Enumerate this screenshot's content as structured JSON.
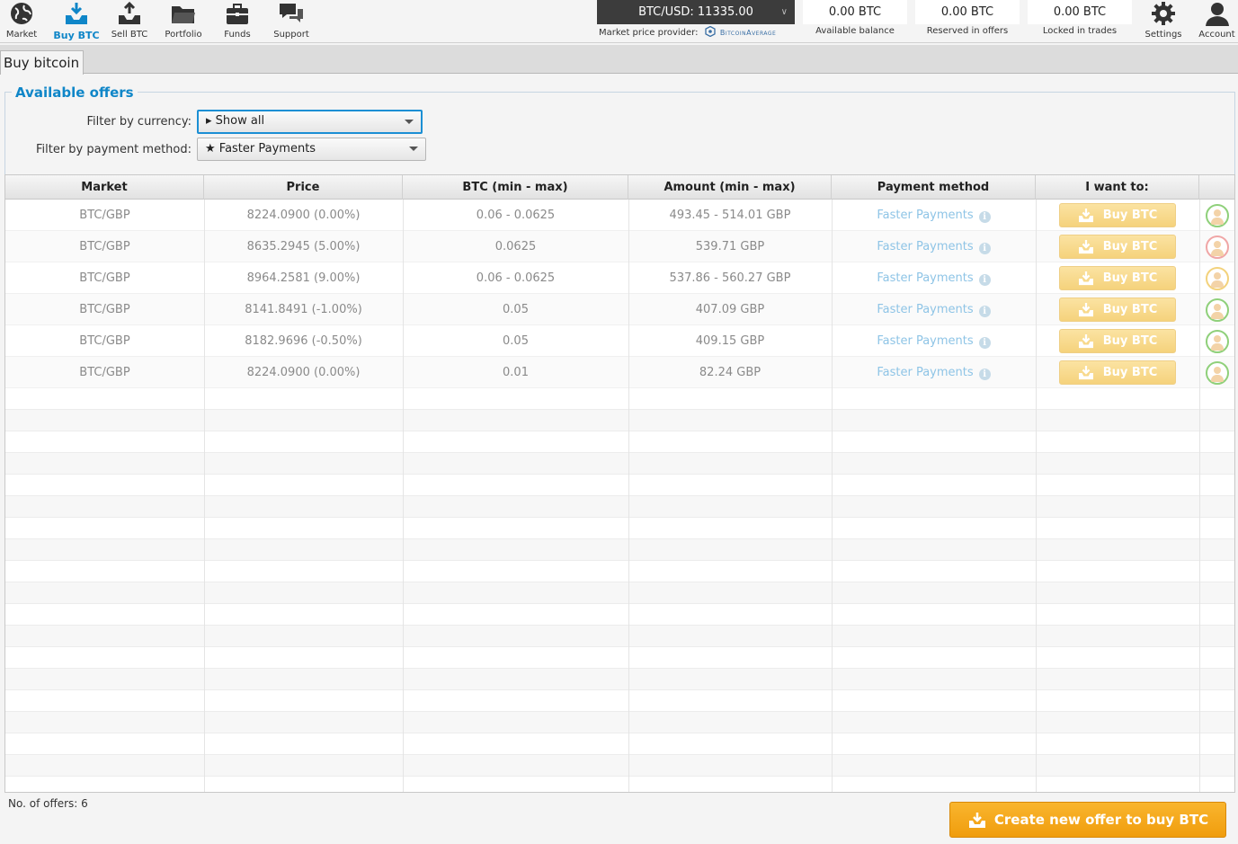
{
  "nav": {
    "market": "Market",
    "buy_btc": "Buy BTC",
    "sell_btc": "Sell BTC",
    "portfolio": "Portfolio",
    "funds": "Funds",
    "support": "Support",
    "settings": "Settings",
    "account": "Account"
  },
  "price": {
    "ticker": "BTC/USD: 11335.00",
    "provider_label": "Market price provider:",
    "provider_name": "BitcoinAverage"
  },
  "balances": [
    {
      "value": "0.00 BTC",
      "caption": "Available balance"
    },
    {
      "value": "0.00 BTC",
      "caption": "Reserved in offers"
    },
    {
      "value": "0.00 BTC",
      "caption": "Locked in trades"
    }
  ],
  "tab": "Buy bitcoin",
  "offers": {
    "title": "Available offers",
    "filter_currency_label": "Filter by currency:",
    "filter_currency_value": "▸ Show all",
    "filter_payment_label": "Filter by payment method:",
    "filter_payment_value": "★ Faster Payments"
  },
  "table": {
    "headers": [
      "Market",
      "Price",
      "BTC (min - max)",
      "Amount (min - max)",
      "Payment method",
      "I want to:"
    ],
    "rows": [
      {
        "market": "BTC/GBP",
        "price": "8224.0900 (0.00%)",
        "btc": "0.06 - 0.0625",
        "amount": "493.45 - 514.01 GBP",
        "payment": "Faster Payments",
        "action": "Buy BTC",
        "avatar_color": "#8fd07a"
      },
      {
        "market": "BTC/GBP",
        "price": "8635.2945 (5.00%)",
        "btc": "0.0625",
        "amount": "539.71 GBP",
        "payment": "Faster Payments",
        "action": "Buy BTC",
        "avatar_color": "#f0a6a6"
      },
      {
        "market": "BTC/GBP",
        "price": "8964.2581 (9.00%)",
        "btc": "0.06 - 0.0625",
        "amount": "537.86 - 560.27 GBP",
        "payment": "Faster Payments",
        "action": "Buy BTC",
        "avatar_color": "#f3d27c"
      },
      {
        "market": "BTC/GBP",
        "price": "8141.8491 (-1.00%)",
        "btc": "0.05",
        "amount": "407.09 GBP",
        "payment": "Faster Payments",
        "action": "Buy BTC",
        "avatar_color": "#8fd07a"
      },
      {
        "market": "BTC/GBP",
        "price": "8182.9696 (-0.50%)",
        "btc": "0.05",
        "amount": "409.15 GBP",
        "payment": "Faster Payments",
        "action": "Buy BTC",
        "avatar_color": "#8fd07a"
      },
      {
        "market": "BTC/GBP",
        "price": "8224.0900 (0.00%)",
        "btc": "0.01",
        "amount": "82.24 GBP",
        "payment": "Faster Payments",
        "action": "Buy BTC",
        "avatar_color": "#8fd07a"
      }
    ]
  },
  "footer": {
    "count": "No. of offers: 6",
    "create_button": "Create new offer to buy BTC"
  },
  "colors": {
    "accent": "#0f86c8",
    "buy_button": "#f5d27c",
    "create_button": "#f0a020"
  }
}
